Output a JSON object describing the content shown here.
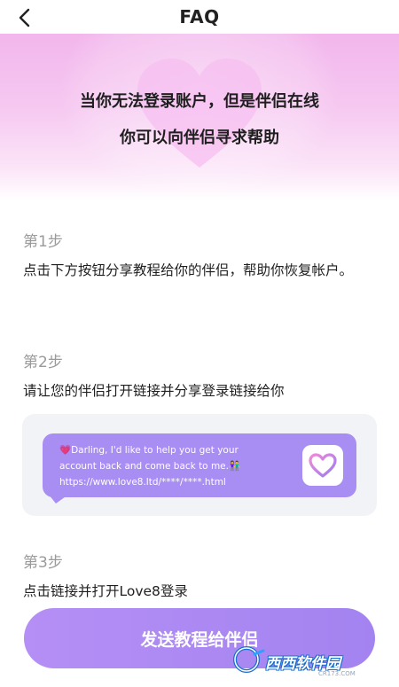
{
  "header": {
    "title": "FAQ"
  },
  "banner": {
    "line1": "当你无法登录账户，但是伴侣在线",
    "line2": "你可以向伴侣寻求帮助"
  },
  "steps": [
    {
      "label": "第1步",
      "text": "点击下方按钮分享教程给你的伴侣，帮助你恢复帐户。"
    },
    {
      "label": "第2步",
      "text": "请让您的伴侣打开链接并分享登录链接给你"
    },
    {
      "label": "第3步",
      "text": "点击链接并打开Love8登录"
    }
  ],
  "share_message": {
    "line1": "Darling, I'd like to help you get your",
    "line2": "account back and come back to me.",
    "line3": "https://www.love8.ltd/****/****.html"
  },
  "send_button": {
    "label": "发送教程给伴侣"
  },
  "watermark": {
    "text": "西西软件园",
    "sub": "CR173.COM"
  },
  "colors": {
    "accent": "#a88df2",
    "banner_pink": "#f2b6ec",
    "button": "#b58ff5"
  }
}
